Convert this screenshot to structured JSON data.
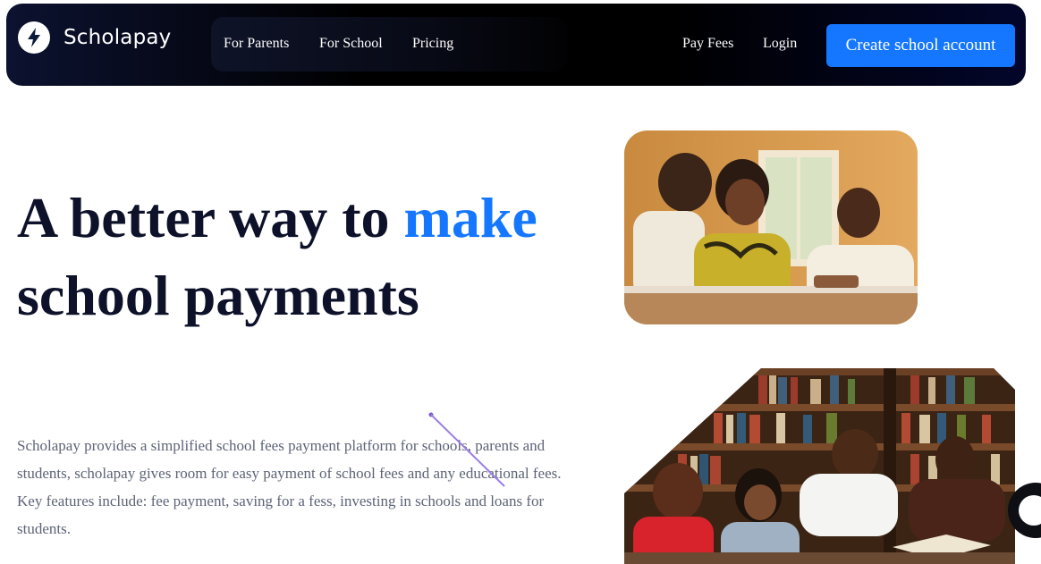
{
  "brand": {
    "name": "Scholapay",
    "logo_icon": "lightning-bolt-icon"
  },
  "nav": {
    "links": [
      {
        "label": "For Parents"
      },
      {
        "label": "For School"
      },
      {
        "label": "Pricing"
      }
    ],
    "pay_fees": "Pay Fees",
    "login": "Login",
    "cta": "Create school account"
  },
  "hero": {
    "title_part1": "A better way to ",
    "title_accent": "make",
    "title_part2": "school payments",
    "description": "Scholapay provides a simplified school fees payment platform for schools, parents and students, scholapay gives room for easy payment of school fees and any educational fees. Key features include: fee payment, saving for a fess, investing in schools and loans for students."
  },
  "colors": {
    "accent": "#1577ff",
    "heading": "#0d1129",
    "body_text": "#5d6477",
    "nav_bg": "#000000"
  },
  "chat": {
    "icon": "chat-icon"
  }
}
